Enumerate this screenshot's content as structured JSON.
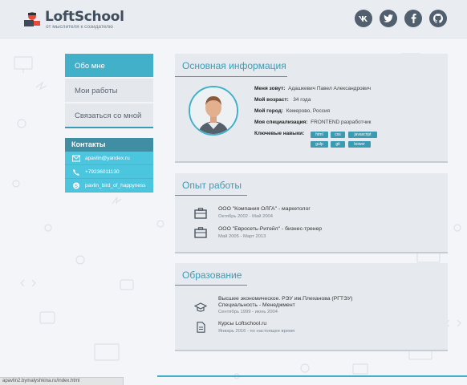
{
  "header": {
    "logo": "LoftSchool",
    "logo_sub": "от мыслителя к созидателю",
    "socials": [
      "vk-icon",
      "twitter-icon",
      "facebook-icon",
      "github-icon"
    ]
  },
  "nav": {
    "items": [
      "Обо мне",
      "Мои работы",
      "Связаться со мной"
    ],
    "active": 0
  },
  "contacts": {
    "title": "Контакты",
    "email": "apavlin@yandex.ru",
    "phone": "+79236011130",
    "skype": "pavlin_bird_of_happyness"
  },
  "basic": {
    "title": "Основная информация",
    "name_label": "Меня зовут:",
    "name": "Адашкевич Павел Александрович",
    "age_label": "Мой возраст:",
    "age": "34 года",
    "city_label": "Мой город:",
    "city": "Кемерово, Россия",
    "spec_label": "Моя специализация:",
    "spec": "FRONTEND разработчик",
    "skills_label": "Ключевые навыки:",
    "skills": [
      "html",
      "css",
      "javascript",
      "gulp",
      "git",
      "bower"
    ]
  },
  "experience": {
    "title": "Опыт работы",
    "items": [
      {
        "title": "ООО \"Компания ОЛГА\" - маркетолог",
        "period": "Октябрь 2002 - Май 2004"
      },
      {
        "title": "ООО \"Евросеть-Ритейл\" - бизнес-тренер",
        "period": "Май 2005 - Март 2013"
      }
    ]
  },
  "education": {
    "title": "Образование",
    "items": [
      {
        "title1": "Высшее экономическое. РЭУ им.Плеханова (РГТЭУ)",
        "title2": "Специальность - Менеджмент",
        "period": "Сентябрь 1999 - июнь 2004"
      },
      {
        "title1": "Курсы Loftschool.ru",
        "period": "Январь 2016 - по настоящее время"
      }
    ]
  },
  "statusbar": "apavlin2.bymalyshkina.ru/index.html",
  "colors": {
    "accent": "#42b0c8",
    "dark": "#525f6e"
  }
}
